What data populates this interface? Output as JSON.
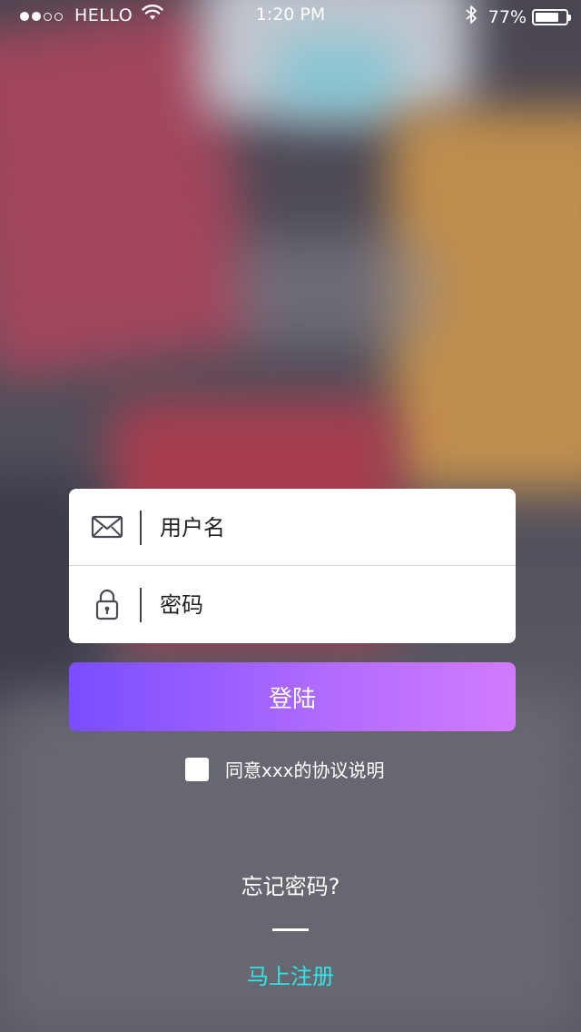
{
  "status_bar": {
    "carrier": "HELLO",
    "time": "1:20 PM",
    "battery_text": "77%",
    "battery_level": 0.77,
    "icons": [
      "signal-dots-icon",
      "wifi-icon",
      "bluetooth-icon",
      "battery-icon"
    ]
  },
  "form": {
    "username_placeholder": "用户名",
    "password_placeholder": "密码",
    "username_icon": "mail-icon",
    "password_icon": "lock-icon"
  },
  "login_button": {
    "label": "登陆"
  },
  "agreement": {
    "text": "同意xxx的协议说明",
    "checked": false
  },
  "forgot_password": "忘记密码?",
  "register_link": "马上注册",
  "colors": {
    "button_gradient_start": "#7a4dff",
    "button_gradient_end": "#d17bff",
    "register_link": "#2ee8e8",
    "card_background": "#ffffff"
  }
}
